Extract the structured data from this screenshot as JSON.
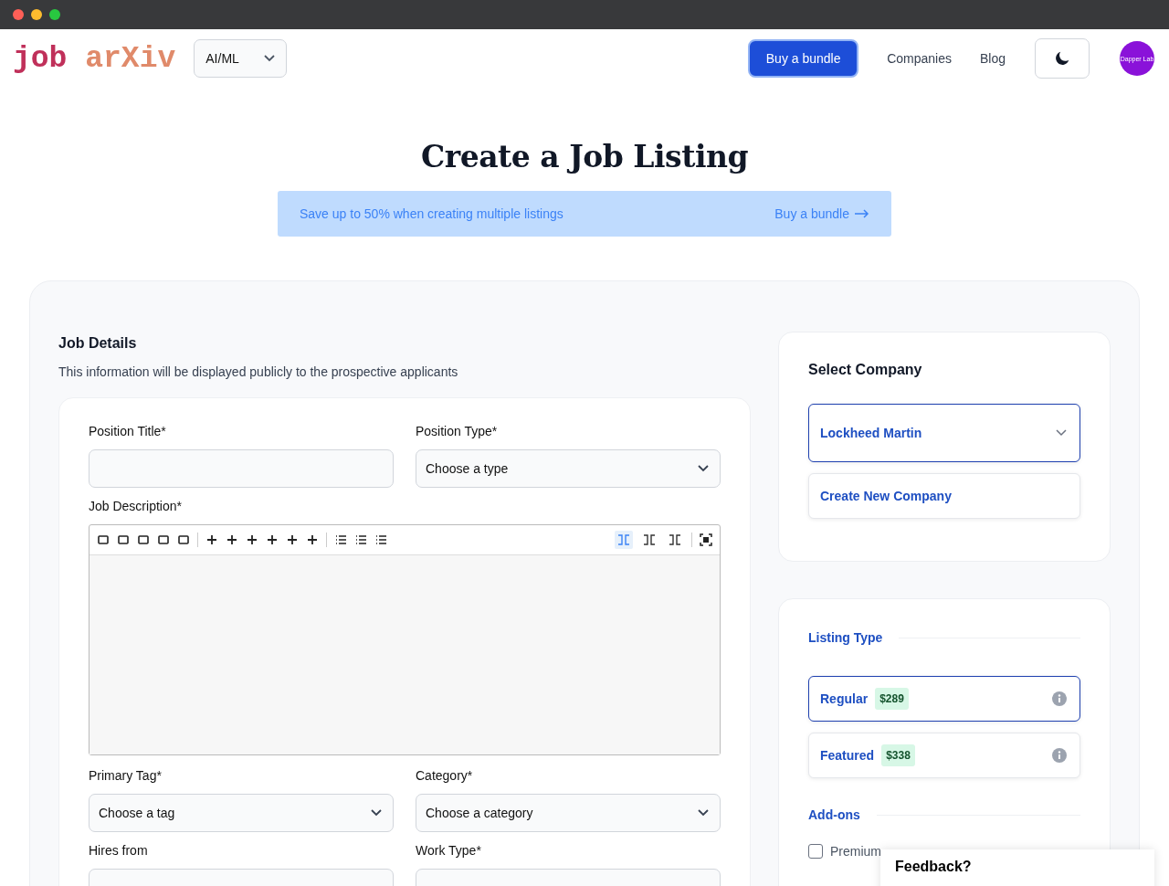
{
  "nav": {
    "logo_left": "job",
    "logo_right": "arXiv",
    "field_select": "AI/ML",
    "buy_button": "Buy a bundle",
    "links": [
      "Companies",
      "Blog"
    ],
    "avatar": "Dapper Lab"
  },
  "page_title": "Create a Job Listing",
  "banner": {
    "text": "Save up to 50% when creating multiple listings",
    "link": "Buy a bundle"
  },
  "job_details": {
    "title": "Job Details",
    "description": "This information will be displayed publicly to the prospective applicants",
    "position_title": {
      "label": "Position Title*"
    },
    "position_type": {
      "label": "Position Type*",
      "value": "Choose a type"
    },
    "job_description": {
      "label": "Job Description*",
      "view_modes": [
        {
          "selected": true
        },
        {
          "selected": false
        },
        {
          "selected": false
        }
      ]
    },
    "primary_tag": {
      "label": "Primary Tag*",
      "value": "Choose a tag"
    },
    "category": {
      "label": "Category*",
      "value": "Choose a category"
    },
    "hires_from": {
      "label": "Hires from"
    },
    "work_type": {
      "label": "Work Type*"
    }
  },
  "select_company": {
    "title": "Select Company",
    "company": "Lockheed Martin",
    "create": "Create New Company"
  },
  "listing_type": {
    "title": "Listing Type",
    "options": [
      {
        "name": "Regular",
        "price": "$289",
        "selected": true
      },
      {
        "name": "Featured",
        "price": "$338",
        "selected": false
      }
    ]
  },
  "addons": {
    "title": "Add-ons",
    "items": [
      {
        "label": "Premium",
        "checked": false
      }
    ]
  },
  "feedback": "Feedback?"
}
